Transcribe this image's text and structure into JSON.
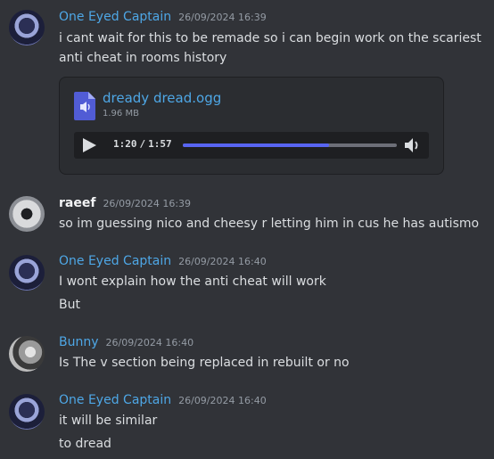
{
  "messages": [
    {
      "author": "One Eyed Captain",
      "timestamp": "26/09/2024 16:39",
      "lines": [
        "i cant wait for this to be remade so i can begin work on the scariest anti cheat in rooms history"
      ],
      "attachment": {
        "file_name": "dready dread.ogg",
        "file_size": "1.96 MB",
        "current_time": "1:20",
        "duration": "1:57",
        "progress_fraction": 0.6838
      }
    },
    {
      "author": "raeef",
      "timestamp": "26/09/2024 16:39",
      "lines": [
        "so im guessing nico and cheesy r letting him in cus he has autismo"
      ]
    },
    {
      "author": "One Eyed Captain",
      "timestamp": "26/09/2024 16:40",
      "lines": [
        "I wont explain how the anti cheat will work",
        "But"
      ]
    },
    {
      "author": "Bunny",
      "timestamp": "26/09/2024 16:40",
      "lines": [
        "Is The v section being replaced in rebuilt or no"
      ]
    },
    {
      "author": "One Eyed Captain",
      "timestamp": "26/09/2024 16:40",
      "lines": [
        "it will be similar",
        "to dread"
      ]
    }
  ],
  "colors": {
    "background": "#313338",
    "name_blue": "#4ea7e6",
    "name_white": "#f2f3f5",
    "timestamp": "#949ba4",
    "progress_fill": "#5865f2"
  },
  "icons": {
    "file": "audio-file-icon",
    "play": "play-icon",
    "volume": "volume-icon"
  }
}
